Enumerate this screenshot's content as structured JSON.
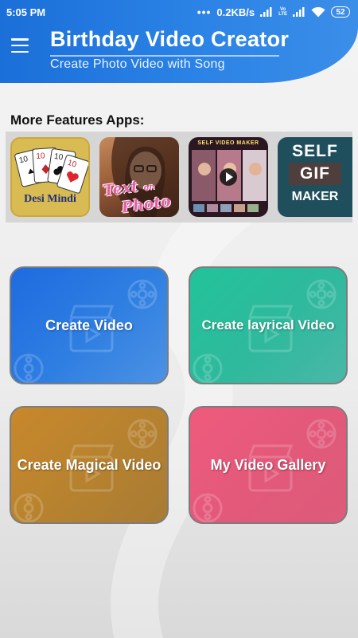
{
  "status_bar": {
    "time": "5:05 PM",
    "dots": "•••",
    "speed": "0.2KB/s",
    "volte_top": "Vo",
    "volte_bottom": "LTE",
    "battery": "52"
  },
  "header": {
    "menu_icon": "hamburger-menu-icon",
    "title": "Birthday Video Creator",
    "subtitle": "Create Photo Video with Song",
    "color": "#1b6fd8"
  },
  "features": {
    "label": "More Features Apps:",
    "apps": [
      {
        "icon": "desi-mindi-app-icon",
        "label": "Desi Mindi"
      },
      {
        "icon": "text-on-photo-app-icon",
        "label_line1": "Text",
        "label_line2": "on",
        "label_line3": "Photo"
      },
      {
        "icon": "self-video-maker-app-icon",
        "label": "SELF VIDEO MAKER"
      },
      {
        "icon": "self-gif-maker-app-icon",
        "line1": "SELF",
        "line2": "GIF",
        "line3": "MAKER"
      }
    ]
  },
  "actions": {
    "create_video": {
      "label": "Create Video",
      "color": "#1d6be0"
    },
    "create_lyrical": {
      "label": "Create layrical Video",
      "color": "#22c39a"
    },
    "create_magical": {
      "label": "Create Magical Video",
      "color": "#c9882c"
    },
    "gallery": {
      "label": "My Video Gallery",
      "color": "#ef5a7d"
    }
  }
}
